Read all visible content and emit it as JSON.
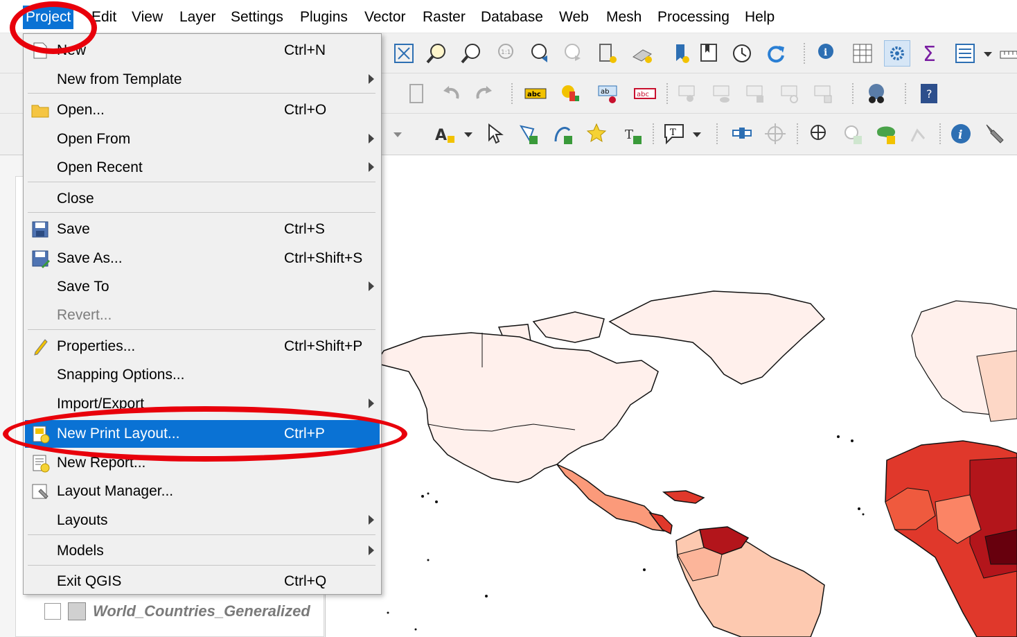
{
  "menubar": {
    "items": [
      {
        "label": "Project",
        "active": true
      },
      {
        "label": "Edit"
      },
      {
        "label": "View"
      },
      {
        "label": "Layer"
      },
      {
        "label": "Settings"
      },
      {
        "label": "Plugins"
      },
      {
        "label": "Vector"
      },
      {
        "label": "Raster"
      },
      {
        "label": "Database"
      },
      {
        "label": "Web"
      },
      {
        "label": "Mesh"
      },
      {
        "label": "Processing"
      },
      {
        "label": "Help"
      }
    ]
  },
  "project_menu": {
    "items": [
      {
        "label": "New",
        "shortcut": "Ctrl+N",
        "icon": "new-file-icon"
      },
      {
        "label": "New from Template",
        "submenu": true
      },
      {
        "label": "Open...",
        "shortcut": "Ctrl+O",
        "icon": "folder-icon"
      },
      {
        "label": "Open From",
        "submenu": true
      },
      {
        "label": "Open Recent",
        "submenu": true
      },
      {
        "label": "Close"
      },
      {
        "label": "Save",
        "shortcut": "Ctrl+S",
        "icon": "save-icon"
      },
      {
        "label": "Save As...",
        "shortcut": "Ctrl+Shift+S",
        "icon": "save-as-icon"
      },
      {
        "label": "Save To",
        "submenu": true
      },
      {
        "label": "Revert...",
        "disabled": true
      },
      {
        "label": "Properties...",
        "shortcut": "Ctrl+Shift+P",
        "icon": "properties-pencil-icon"
      },
      {
        "label": "Snapping Options..."
      },
      {
        "label": "Import/Export",
        "submenu": true
      },
      {
        "label": "New Print Layout...",
        "shortcut": "Ctrl+P",
        "icon": "new-print-layout-icon",
        "highlighted": true
      },
      {
        "label": "New Report...",
        "icon": "new-report-icon"
      },
      {
        "label": "Layout Manager...",
        "icon": "layout-manager-icon"
      },
      {
        "label": "Layouts",
        "submenu": true
      },
      {
        "label": "Models",
        "submenu": true
      },
      {
        "label": "Exit QGIS",
        "shortcut": "Ctrl+Q"
      }
    ]
  },
  "layers": {
    "items": [
      {
        "name": "World_Countries_Generalized",
        "checked": false
      }
    ]
  },
  "colors": {
    "accent": "#0a72d4",
    "annotation": "#e8000b",
    "map_light": "#fff0ec",
    "map_mid": "#fb9a7a",
    "map_red": "#e0382b",
    "map_dark": "#b3151b"
  }
}
